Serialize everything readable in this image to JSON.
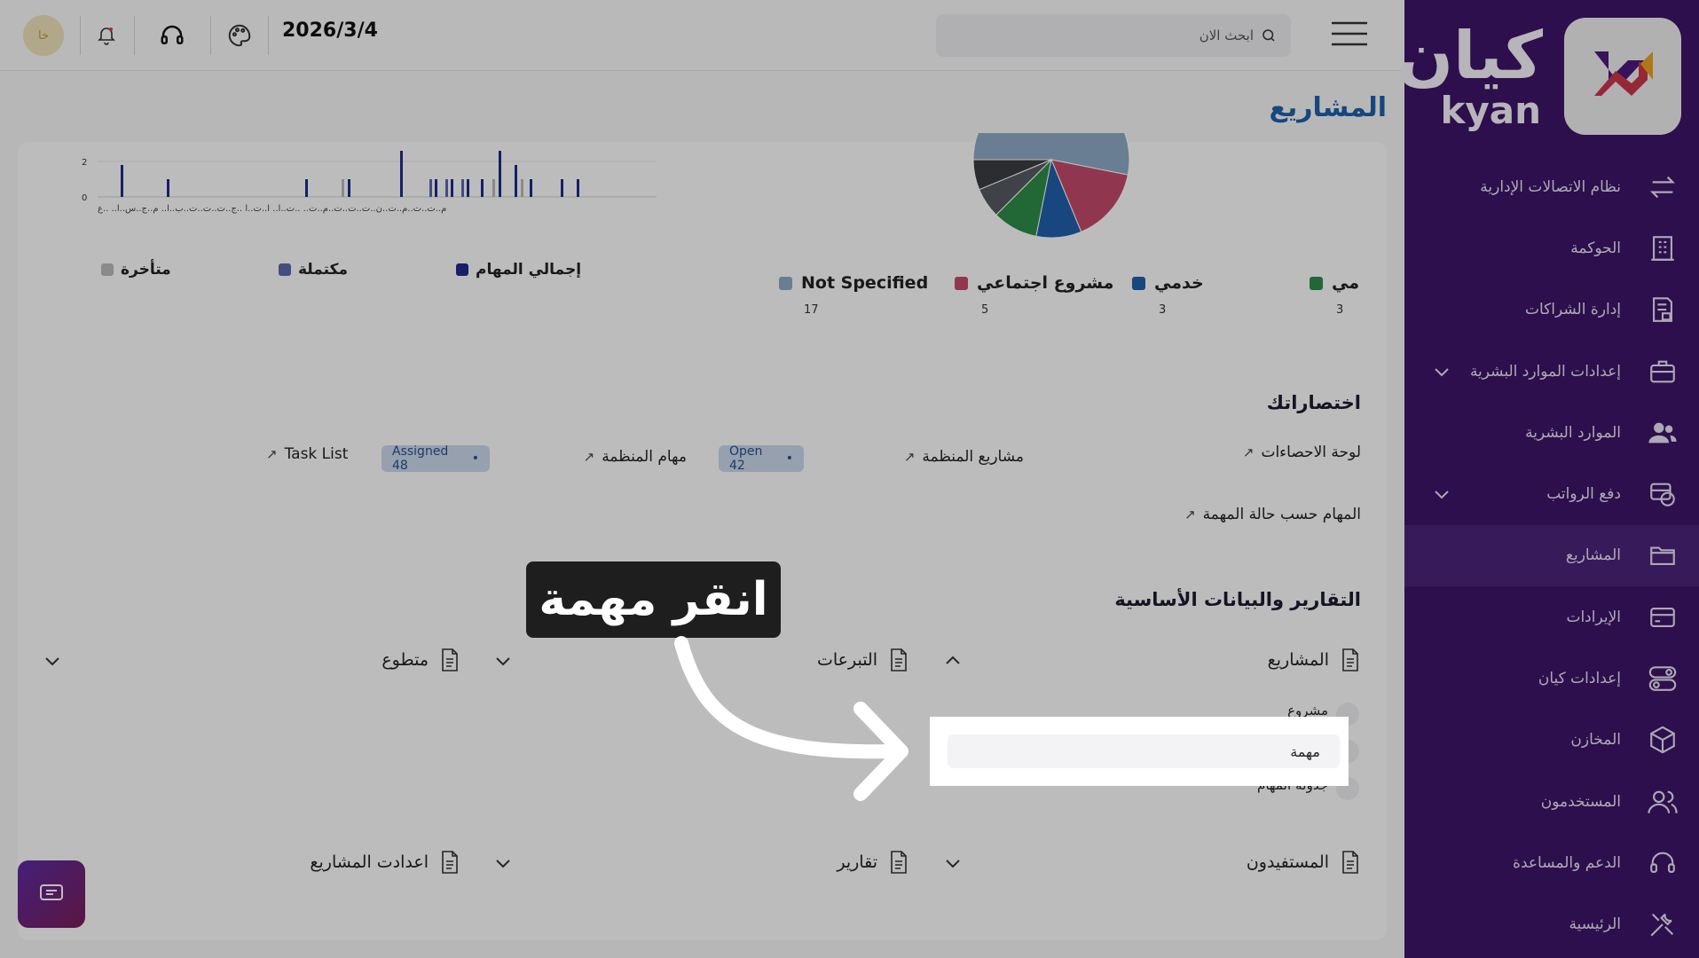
{
  "topbar": {
    "date": "2026/3/4",
    "search_placeholder": "ابحث الان",
    "avatar_initials": "خا"
  },
  "sidebar": {
    "brand_ar": "كيان",
    "brand_en": "kyan",
    "items": [
      {
        "label": "نظام الاتصالات الإدارية",
        "icon": "arrows-exchange-icon",
        "expandable": false
      },
      {
        "label": "الحوكمة",
        "icon": "building-icon",
        "expandable": false
      },
      {
        "label": "إدارة الشراكات",
        "icon": "document-lock-icon",
        "expandable": false
      },
      {
        "label": "إعدادات الموارد البشرية",
        "icon": "briefcase-icon",
        "expandable": true
      },
      {
        "label": "الموارد البشرية",
        "icon": "users-icon",
        "expandable": false
      },
      {
        "label": "دفع الرواتب",
        "icon": "money-icon",
        "expandable": true
      },
      {
        "label": "المشاريع",
        "icon": "folder-icon",
        "expandable": false,
        "active": true
      },
      {
        "label": "الإيرادات",
        "icon": "card-icon",
        "expandable": false
      },
      {
        "label": "إعدادات كيان",
        "icon": "toggle-icon",
        "expandable": false
      },
      {
        "label": "المخازن",
        "icon": "box-icon",
        "expandable": false
      },
      {
        "label": "المستخدمون",
        "icon": "user-group-icon",
        "expandable": false
      },
      {
        "label": "الدعم والمساعدة",
        "icon": "headset-icon",
        "expandable": false
      },
      {
        "label": "الرئيسية",
        "icon": "tools-icon",
        "expandable": false
      }
    ]
  },
  "page": {
    "title": "المشاريع"
  },
  "chart_data": [
    {
      "type": "bar",
      "ylim": [
        0,
        2
      ],
      "yticks": [
        "0",
        "2"
      ],
      "tick_labels_text": "م..ت..ت..م..ت..ن..ت..ت..ت..م..ت.. ..ت..ا.. ا..ت..ا ..ج..ت..ت..ت..ب..ا.. م..ج..س..ا.. ..ع",
      "series": [
        {
          "name": "إجمالي المهام",
          "color": "#1e2a8a"
        },
        {
          "name": "مكتملة",
          "color": "#5a67a8"
        },
        {
          "name": "متأخرة",
          "color": "#b9b9bd"
        }
      ]
    },
    {
      "type": "pie",
      "legend": [
        {
          "name": "Not Specified",
          "value": 17,
          "color": "#8da9c4"
        },
        {
          "name": "مشروع اجتماعي",
          "value": 5,
          "color": "#c04a6a"
        },
        {
          "name": "خدمي",
          "value": 3,
          "color": "#1f5fa8"
        },
        {
          "name": "مي",
          "value": 3,
          "color": "#2e8b4a"
        }
      ]
    }
  ],
  "shortcuts": {
    "title": "اختصاراتك",
    "items": [
      {
        "label": "لوحة الاحصاءات"
      },
      {
        "label": "مشاريع المنظمة"
      },
      {
        "label": "مهام المنظمة",
        "badge": "Open 42"
      },
      {
        "label": "Task List",
        "badge": "Assigned 48"
      },
      {
        "label": "المهام حسب حالة المهمة"
      }
    ]
  },
  "reports": {
    "title": "التقارير والبيانات الأساسية",
    "groups": [
      {
        "label": "المشاريع",
        "expanded": true,
        "children": [
          "مشروع",
          "مهمة",
          "جدولة المهام"
        ]
      },
      {
        "label": "التبرعات"
      },
      {
        "label": "متطوع"
      },
      {
        "label": "المستفيدون"
      },
      {
        "label": "تقارير"
      },
      {
        "label": "اعدادت المشاريع"
      }
    ]
  },
  "overlay": {
    "instruction": "انقر مهمة",
    "highlight_label": "مهمة"
  }
}
